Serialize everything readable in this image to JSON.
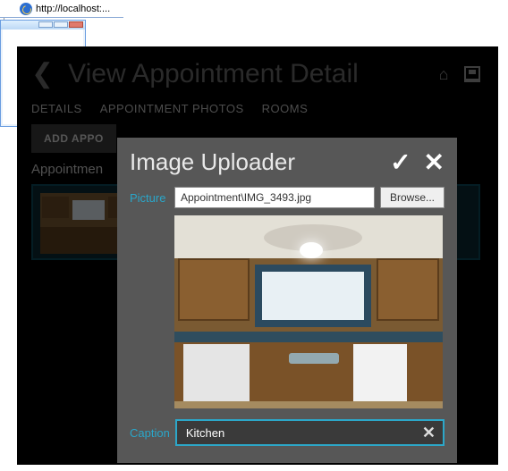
{
  "browser": {
    "url_display": "http://localhost:..."
  },
  "header": {
    "title": "View Appointment Detail"
  },
  "tabs": {
    "details": "DETAILS",
    "photos": "APPOINTMENT PHOTOS",
    "rooms": "ROOMS"
  },
  "toolbar": {
    "add_label": "ADD APPO"
  },
  "subhead": "Appointmen",
  "uploader": {
    "title": "Image Uploader",
    "picture_label": "Picture",
    "file_value": "Appointment\\IMG_3493.jpg",
    "browse_label": "Browse...",
    "caption_label": "Caption",
    "caption_value": "Kitchen",
    "accent_color": "#2ca7c9"
  }
}
